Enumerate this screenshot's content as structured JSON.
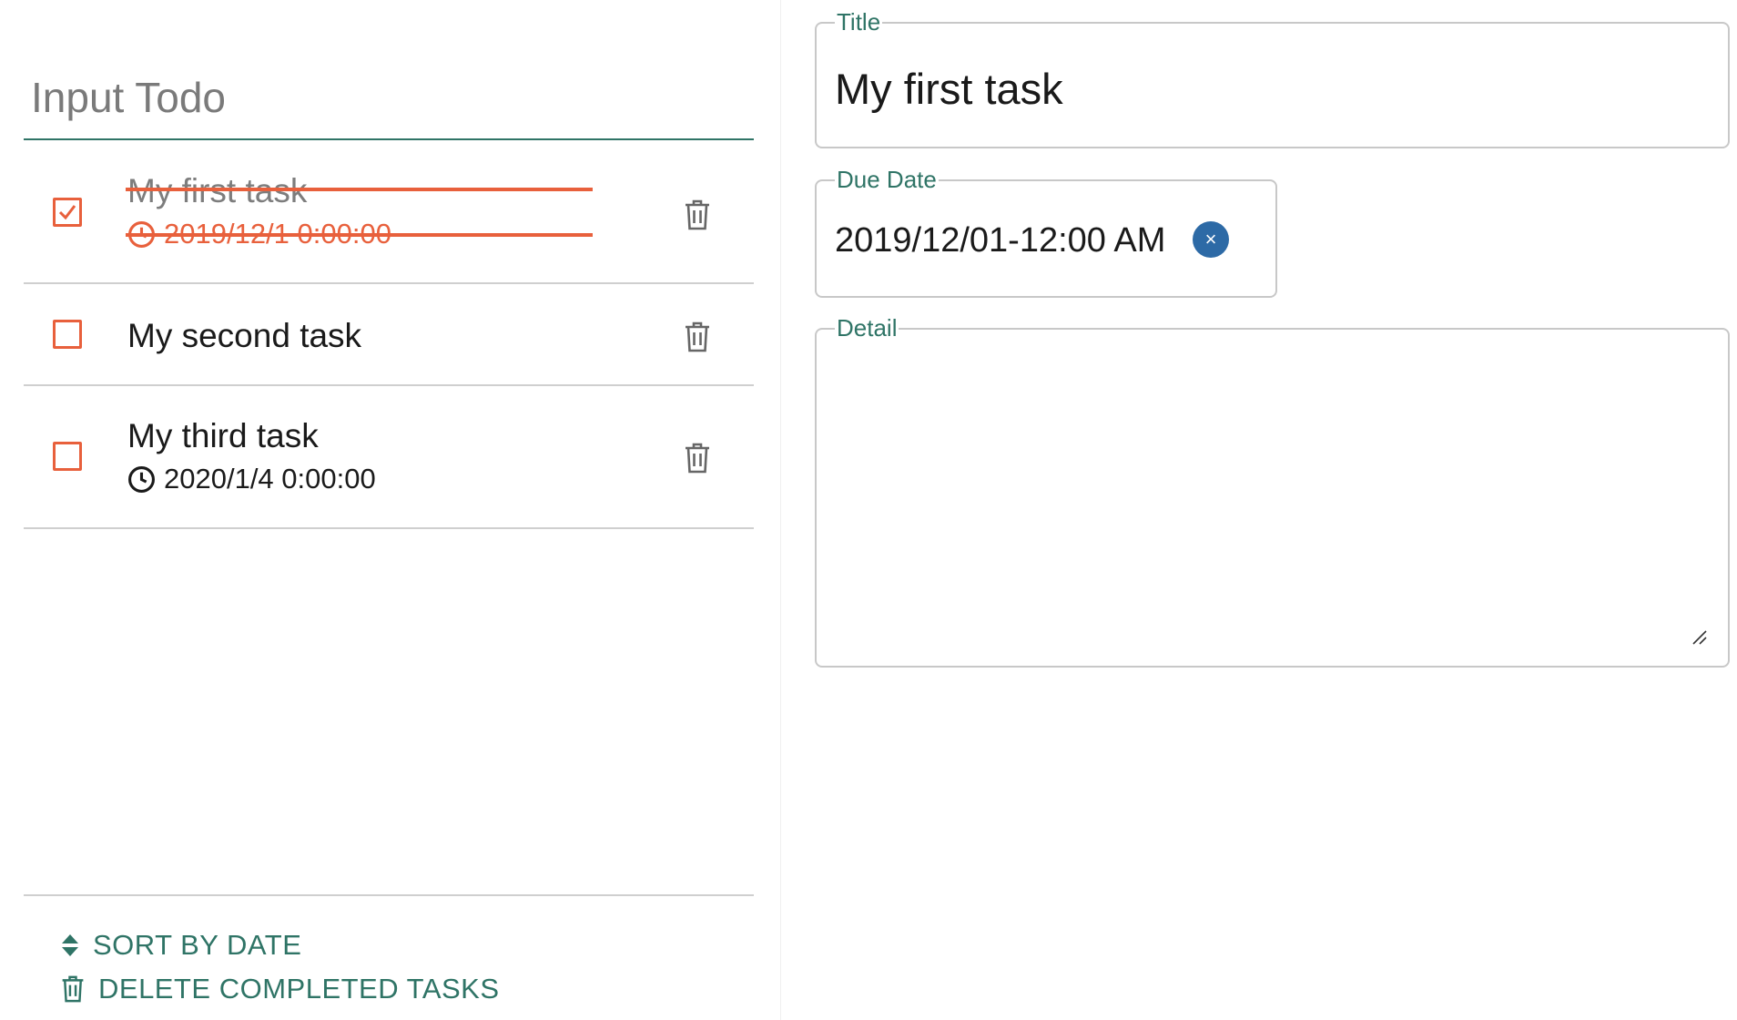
{
  "todo_input": {
    "placeholder": "Input Todo",
    "value": ""
  },
  "todos": [
    {
      "title": "My first task",
      "due": "2019/12/1 0:00:00",
      "completed": true
    },
    {
      "title": "My second task",
      "due": "",
      "completed": false
    },
    {
      "title": "My third task",
      "due": "2020/1/4 0:00:00",
      "completed": false
    }
  ],
  "footer": {
    "sort_label": "SORT BY DATE",
    "delete_completed_label": "DELETE COMPLETED TASKS"
  },
  "editor": {
    "title_legend": "Title",
    "title_value": "My first task",
    "due_legend": "Due Date",
    "due_value": "2019/12/01-12:00 AM",
    "clear_glyph": "×",
    "detail_legend": "Detail",
    "detail_value": ""
  },
  "colors": {
    "accent": "#2f7466",
    "checkbox": "#e8603c",
    "completed_strike": "#e8603c",
    "clear_button": "#2d6aa6"
  },
  "icons": {
    "checkbox_checked": "check-icon",
    "clock": "clock-icon",
    "delete": "trash-icon",
    "sort": "sort-arrows-icon",
    "clear": "close-icon"
  }
}
